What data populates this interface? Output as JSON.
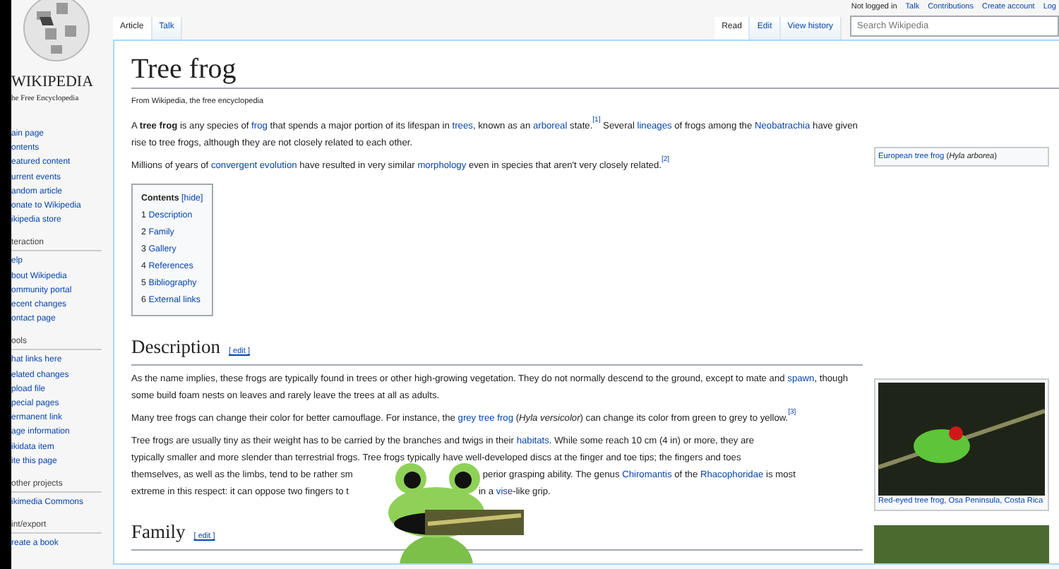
{
  "logo": {
    "wordmark": "WIKIPEDIA",
    "tagline": "he Free Encyclopedia"
  },
  "sidebar": {
    "sections": [
      {
        "items": [
          "ain page",
          "ontents",
          "eatured content",
          "urrent events",
          "andom article",
          "onate to Wikipedia",
          "ikipedia store"
        ]
      },
      {
        "heading": "teraction",
        "items": [
          "elp",
          "bout Wikipedia",
          "ommunity portal",
          "ecent changes",
          "ontact page"
        ]
      },
      {
        "heading": "ools",
        "items": [
          "hat links here",
          "elated changes",
          "pload file",
          "pecial pages",
          "ermanent link",
          "age information",
          "ikidata item",
          "ite this page"
        ]
      },
      {
        "heading": "other projects",
        "items": [
          "ikimedia Commons"
        ]
      },
      {
        "heading": "int/export",
        "items": [
          "reate a book"
        ]
      }
    ]
  },
  "personal_bar": {
    "status": "Not logged in",
    "links": [
      "Talk",
      "Contributions",
      "Create account",
      "Log"
    ]
  },
  "page_tabs": [
    {
      "label": "Article",
      "selected": true
    },
    {
      "label": "Talk",
      "selected": false
    }
  ],
  "view_tabs": [
    {
      "label": "Read",
      "selected": true
    },
    {
      "label": "Edit",
      "selected": false
    },
    {
      "label": "View history",
      "selected": false
    }
  ],
  "search": {
    "placeholder": "Search Wikipedia"
  },
  "article": {
    "title": "Tree frog",
    "subtitle": "From Wikipedia, the free encyclopedia",
    "intro": [
      [
        {
          "kind": "plain",
          "text": "A "
        },
        {
          "kind": "bold",
          "text": "tree frog"
        },
        {
          "kind": "plain",
          "text": " is any species of "
        },
        {
          "kind": "link",
          "text": "frog"
        },
        {
          "kind": "plain",
          "text": " that spends a major portion of its lifespan in "
        },
        {
          "kind": "link",
          "text": "trees"
        },
        {
          "kind": "plain",
          "text": ", known as an "
        },
        {
          "kind": "link",
          "text": "arboreal"
        },
        {
          "kind": "plain",
          "text": " state."
        },
        {
          "kind": "ref",
          "text": "[1]"
        },
        {
          "kind": "plain",
          "text": " Several "
        },
        {
          "kind": "link",
          "text": "lineages"
        },
        {
          "kind": "plain",
          "text": " of frogs among the "
        },
        {
          "kind": "link",
          "text": "Neobatrachia"
        },
        {
          "kind": "plain",
          "text": " have given rise to tree frogs, although they are not closely related to each other."
        }
      ],
      [
        {
          "kind": "plain",
          "text": "Millions of years of "
        },
        {
          "kind": "link",
          "text": "convergent evolution"
        },
        {
          "kind": "plain",
          "text": " have resulted in very similar "
        },
        {
          "kind": "link",
          "text": "morphology"
        },
        {
          "kind": "plain",
          "text": " even in species that aren't very closely related."
        },
        {
          "kind": "ref",
          "text": "[2]"
        }
      ]
    ],
    "toc": {
      "title": "Contents",
      "toggle": "[hide]",
      "entries": [
        {
          "number": "1",
          "label": "Description"
        },
        {
          "number": "2",
          "label": "Family"
        },
        {
          "number": "3",
          "label": "Gallery"
        },
        {
          "number": "4",
          "label": "References"
        },
        {
          "number": "5",
          "label": "Bibliography"
        },
        {
          "number": "6",
          "label": "External links"
        }
      ]
    },
    "infobox_caption": [
      {
        "kind": "link",
        "text": "European tree frog"
      },
      {
        "kind": "plain",
        "text": " ("
      },
      {
        "kind": "italic",
        "text": "Hyla arborea"
      },
      {
        "kind": "plain",
        "text": ")"
      }
    ],
    "sections": [
      {
        "heading": "Description",
        "edit": "[ edit ]",
        "paragraphs": [
          [
            {
              "kind": "plain",
              "text": "As the name implies, these frogs are typically found in trees or other high-growing vegetation. They do not normally descend to the ground, except to mate and "
            },
            {
              "kind": "link",
              "text": "spawn"
            },
            {
              "kind": "plain",
              "text": ", though some build foam nests on leaves and rarely leave the trees at all as adults."
            }
          ],
          [
            {
              "kind": "plain",
              "text": "Many tree frogs can change their color for better camouflage. For instance, the "
            },
            {
              "kind": "link",
              "text": "grey tree frog"
            },
            {
              "kind": "plain",
              "text": " ("
            },
            {
              "kind": "italic",
              "text": "Hyla versicolor"
            },
            {
              "kind": "plain",
              "text": ") can change its color from green to grey to yellow."
            },
            {
              "kind": "ref",
              "text": "[3]"
            }
          ]
        ],
        "covered_lines": [
          [
            [
              {
                "kind": "plain",
                "text": "Tree frogs are usually tiny as their weight has to be carried by the branches and twigs in their "
              },
              {
                "kind": "link",
                "text": "habitats"
              },
              {
                "kind": "plain",
                "text": ". While some reach 10 cm (4 in) or more, they are"
              }
            ]
          ],
          [
            [
              {
                "kind": "plain",
                "text": "typically smaller and more slender than terrestrial frogs. Tree frogs typically have well-developed discs at the finger and toe tips; the fingers and toes"
              }
            ]
          ],
          [
            [
              {
                "kind": "plain",
                "text": "themselves, as well as the limbs, tend to be rather sm"
              }
            ],
            [
              {
                "kind": "plain",
                "text": "perior grasping ability. The genus "
              },
              {
                "kind": "link",
                "text": "Chiromantis"
              },
              {
                "kind": "plain",
                "text": " of the "
              },
              {
                "kind": "link",
                "text": "Rhacophoridae"
              },
              {
                "kind": "plain",
                "text": " is most"
              }
            ]
          ],
          [
            [
              {
                "kind": "plain",
                "text": "extreme in this respect: it can oppose two fingers to t"
              }
            ],
            [
              {
                "kind": "plain",
                "text": "in a "
              },
              {
                "kind": "link",
                "text": "vise"
              },
              {
                "kind": "plain",
                "text": "-like grip."
              }
            ]
          ]
        ]
      },
      {
        "heading": "Family",
        "edit": "[ edit ]"
      }
    ],
    "figure": {
      "caption": "Red-eyed tree frog, Osa Peninsula, Costa Rica"
    }
  }
}
